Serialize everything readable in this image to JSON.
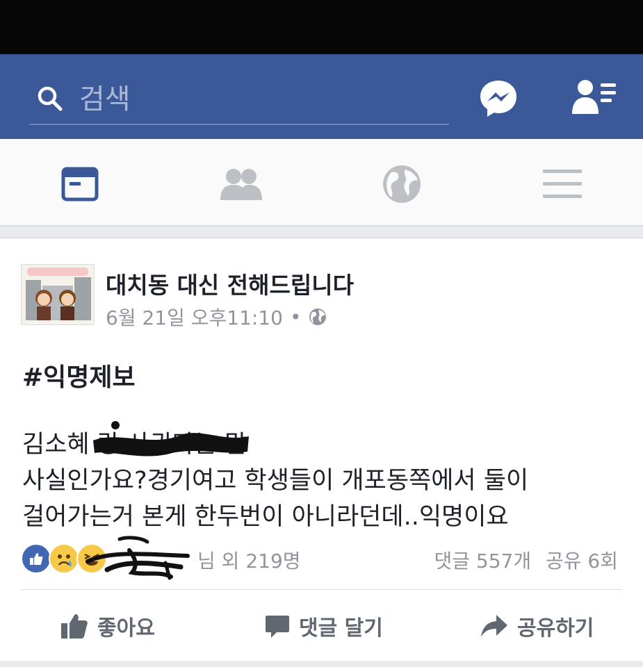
{
  "header": {
    "search": {
      "placeholder": "검색"
    },
    "icons": [
      "search-icon",
      "messenger-icon",
      "friend-requests-icon"
    ]
  },
  "nav": {
    "tabs": [
      {
        "icon": "news-feed-icon",
        "active": true
      },
      {
        "icon": "friends-icon",
        "active": false
      },
      {
        "icon": "globe-icon",
        "active": false
      },
      {
        "icon": "menu-icon",
        "active": false
      }
    ]
  },
  "post": {
    "page_name": "대치동 대신 전해드립니다",
    "timestamp": "6월 21일 오후11:10",
    "dot": "•",
    "privacy_icon": "globe-icon",
    "hashtag": "#익명제보",
    "body": "김소혜              랑 사귄다는 말\n사실인가요?경기여고 학생들이 개포동쪽에서 둘이\n걸어가는거 본게 한두번이 아니라던데..익명이요",
    "reactions": {
      "icons": [
        "like-reaction-icon",
        "sad-reaction-icon",
        "haha-reaction-icon"
      ],
      "text": "님 외 219명"
    },
    "comments": "댓글 557개",
    "shares": "공유 6회"
  },
  "actions": {
    "like": "좋아요",
    "comment": "댓글 달기",
    "share": "공유하기"
  },
  "colors": {
    "brand_blue": "#3b5998",
    "like_blue": "#4267b2",
    "reaction_yellow": "#f7c948",
    "meta_gray": "#90949c"
  }
}
